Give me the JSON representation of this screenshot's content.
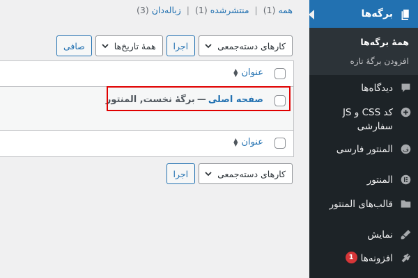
{
  "sidebar": {
    "active": {
      "label": "برگه‌ها",
      "icon": "pages-icon"
    },
    "submenu": {
      "current": "همهٔ برگه‌ها",
      "add_new": "افزودن برگهٔ تازه"
    },
    "items": [
      {
        "label": "دیدگاه‌ها",
        "icon": "comments-icon"
      },
      {
        "label": "کد CSS و JS سفارشی",
        "icon": "plus-circle-icon"
      },
      {
        "label": "المنتور فارسی",
        "icon": "elementor-farsi-icon"
      },
      {
        "label": "المنتور",
        "icon": "elementor-icon"
      },
      {
        "label": "قالب‌های المنتور",
        "icon": "folder-icon"
      },
      {
        "label": "نمایش",
        "icon": "appearance-icon"
      },
      {
        "label": "افزونه‌ها",
        "icon": "plugins-icon",
        "badge": "1"
      }
    ]
  },
  "views": {
    "all": "همه",
    "all_count": "(1)",
    "published": "منتشرشده",
    "published_count": "(1)",
    "trash": "زباله‌دان",
    "trash_count": "(3)",
    "separator": "|"
  },
  "top_nav": {
    "bulk_actions": "کارهای دسته‌جمعی",
    "apply": "اجرا",
    "dates": "همهٔ تاریخ‌ها",
    "filter": "صافی"
  },
  "table": {
    "header_title": "عنوان",
    "footer_title": "عنوان",
    "rows": [
      {
        "title": "صفحه اصلی",
        "dash": "—",
        "state": "برگهٔ نخست, المنتور"
      }
    ]
  },
  "bottom_nav": {
    "bulk_actions": "کارهای دسته‌جمعی",
    "apply": "اجرا"
  },
  "colors": {
    "accent": "#2271b1",
    "sidebar_bg": "#1d2327",
    "highlight": "#e00000",
    "badge": "#d63638"
  }
}
